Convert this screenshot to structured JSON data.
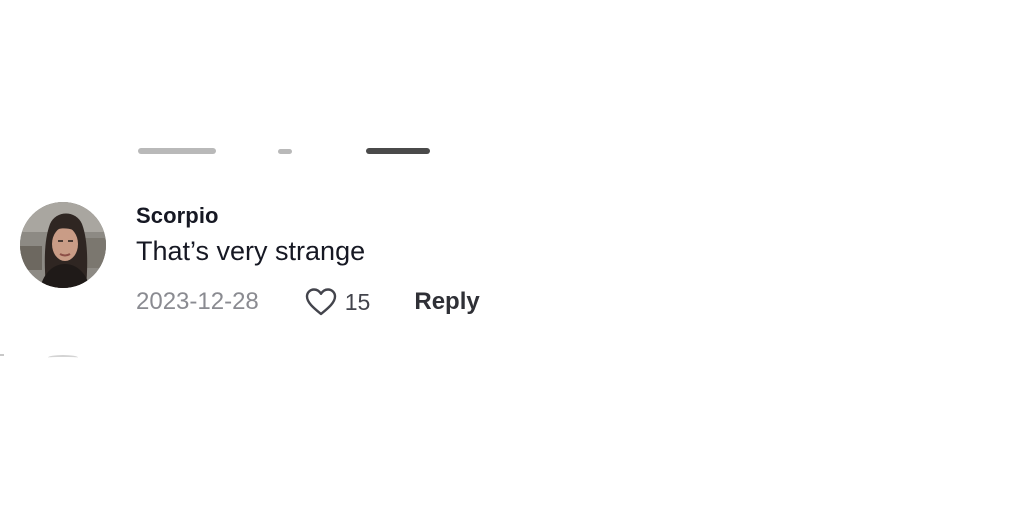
{
  "comment": {
    "username": "Scorpio",
    "text": "That’s very strange",
    "date": "2023-12-28",
    "like_count": "15",
    "reply_label": "Reply"
  },
  "icons": {
    "like": "heart-outline-icon",
    "avatar": "user-avatar-photo"
  },
  "colors": {
    "primary_text": "#161823",
    "secondary_text": "#8a8b91",
    "background": "#ffffff"
  }
}
